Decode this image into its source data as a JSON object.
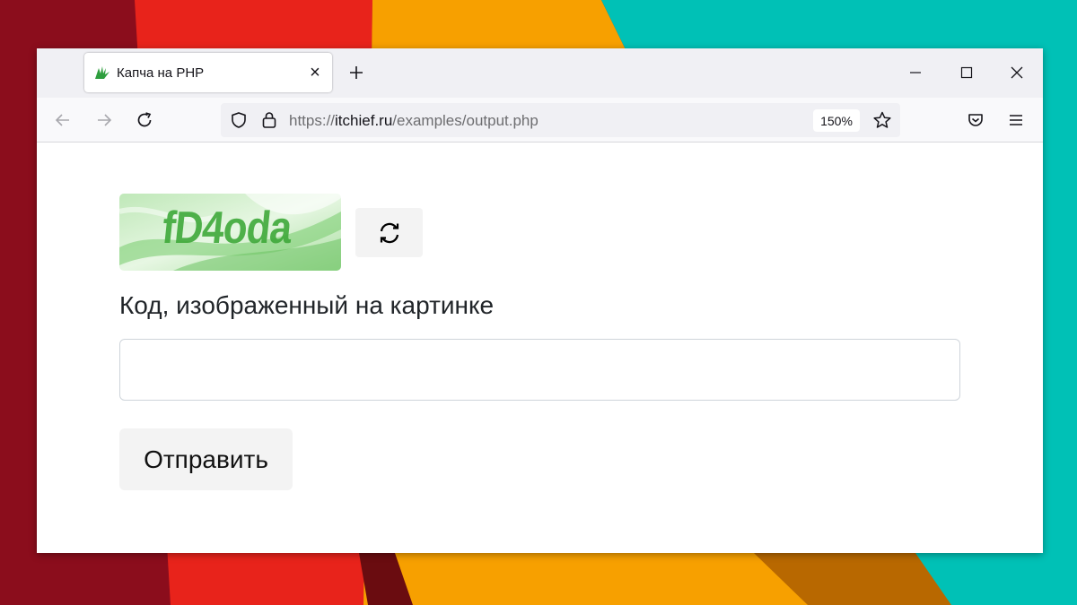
{
  "tab": {
    "title": "Капча на PHP",
    "favicon": "hand-logo-icon"
  },
  "navbar": {
    "url_prefix": "https://",
    "url_domain": "itchief.ru",
    "url_path": "/examples/output.php",
    "zoom": "150%"
  },
  "page": {
    "captcha_text": "fD4oda",
    "code_label": "Код, изображенный на картинке",
    "code_value": "",
    "submit_label": "Отправить"
  },
  "colors": {
    "wallpaper_red": "#e8231b",
    "wallpaper_orange": "#f7a000",
    "wallpaper_teal": "#00c1b6",
    "wallpaper_dark": "#8b0d1c",
    "captcha_green": "#3fa93a",
    "favicon_green": "#2e9e3e"
  }
}
